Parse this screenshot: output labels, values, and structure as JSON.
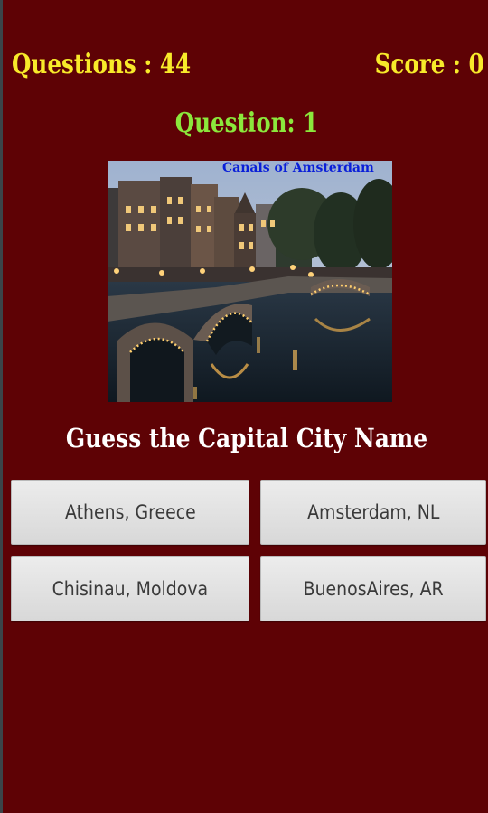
{
  "header": {
    "questions_label": "Questions : 44",
    "score_label": "Score : 0"
  },
  "question": {
    "number_label": "Question: 1",
    "image_caption": "Canals of Amsterdam",
    "prompt": "Guess the Capital City Name"
  },
  "answers": [
    {
      "label": "Athens, Greece"
    },
    {
      "label": "Amsterdam, NL"
    },
    {
      "label": "Chisinau, Moldova"
    },
    {
      "label": "BuenosAires, AR"
    }
  ],
  "colors": {
    "background": "#5e0205",
    "stat_text": "#f8ea2a",
    "question_number": "#8be83c",
    "caption": "#0a1fd8",
    "prompt": "#ffffff",
    "button": "#e0e0e0"
  }
}
